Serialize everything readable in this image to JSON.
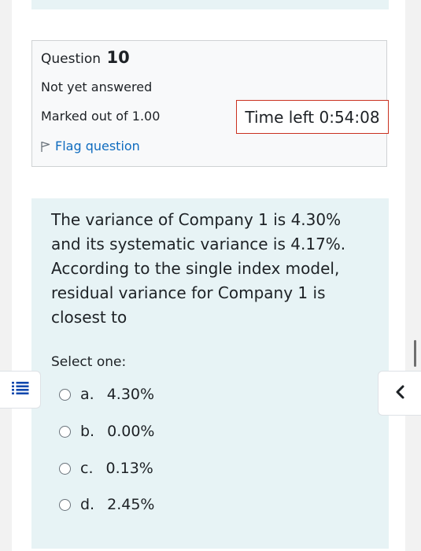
{
  "question_info": {
    "question_label": "Question",
    "question_number": "10",
    "state": "Not yet answered",
    "grade": "Marked out of 1.00",
    "flag_label": "Flag question"
  },
  "timer": {
    "text": "Time left 0:54:08",
    "border_color": "#ca3120"
  },
  "question": {
    "text": "The variance of Company 1 is 4.30% and its systematic variance is 4.17%. According to the single index model, residual variance for Company 1 is closest to",
    "prompt": "Select one:",
    "answers": [
      {
        "letter": "a.",
        "value": "4.30%"
      },
      {
        "letter": "b.",
        "value": "0.00%"
      },
      {
        "letter": "c.",
        "value": "0.13%"
      },
      {
        "letter": "d.",
        "value": "2.45%"
      }
    ]
  },
  "icons": {
    "flag": "flag-icon",
    "nav": "quiz-navigation-icon",
    "drawer": "chevron-left-icon"
  },
  "colors": {
    "link": "#0f6cbf",
    "formulation_bg": "#e7f3f5",
    "info_bg": "#f8f9fa",
    "nav_icon": "#0f47ad"
  }
}
